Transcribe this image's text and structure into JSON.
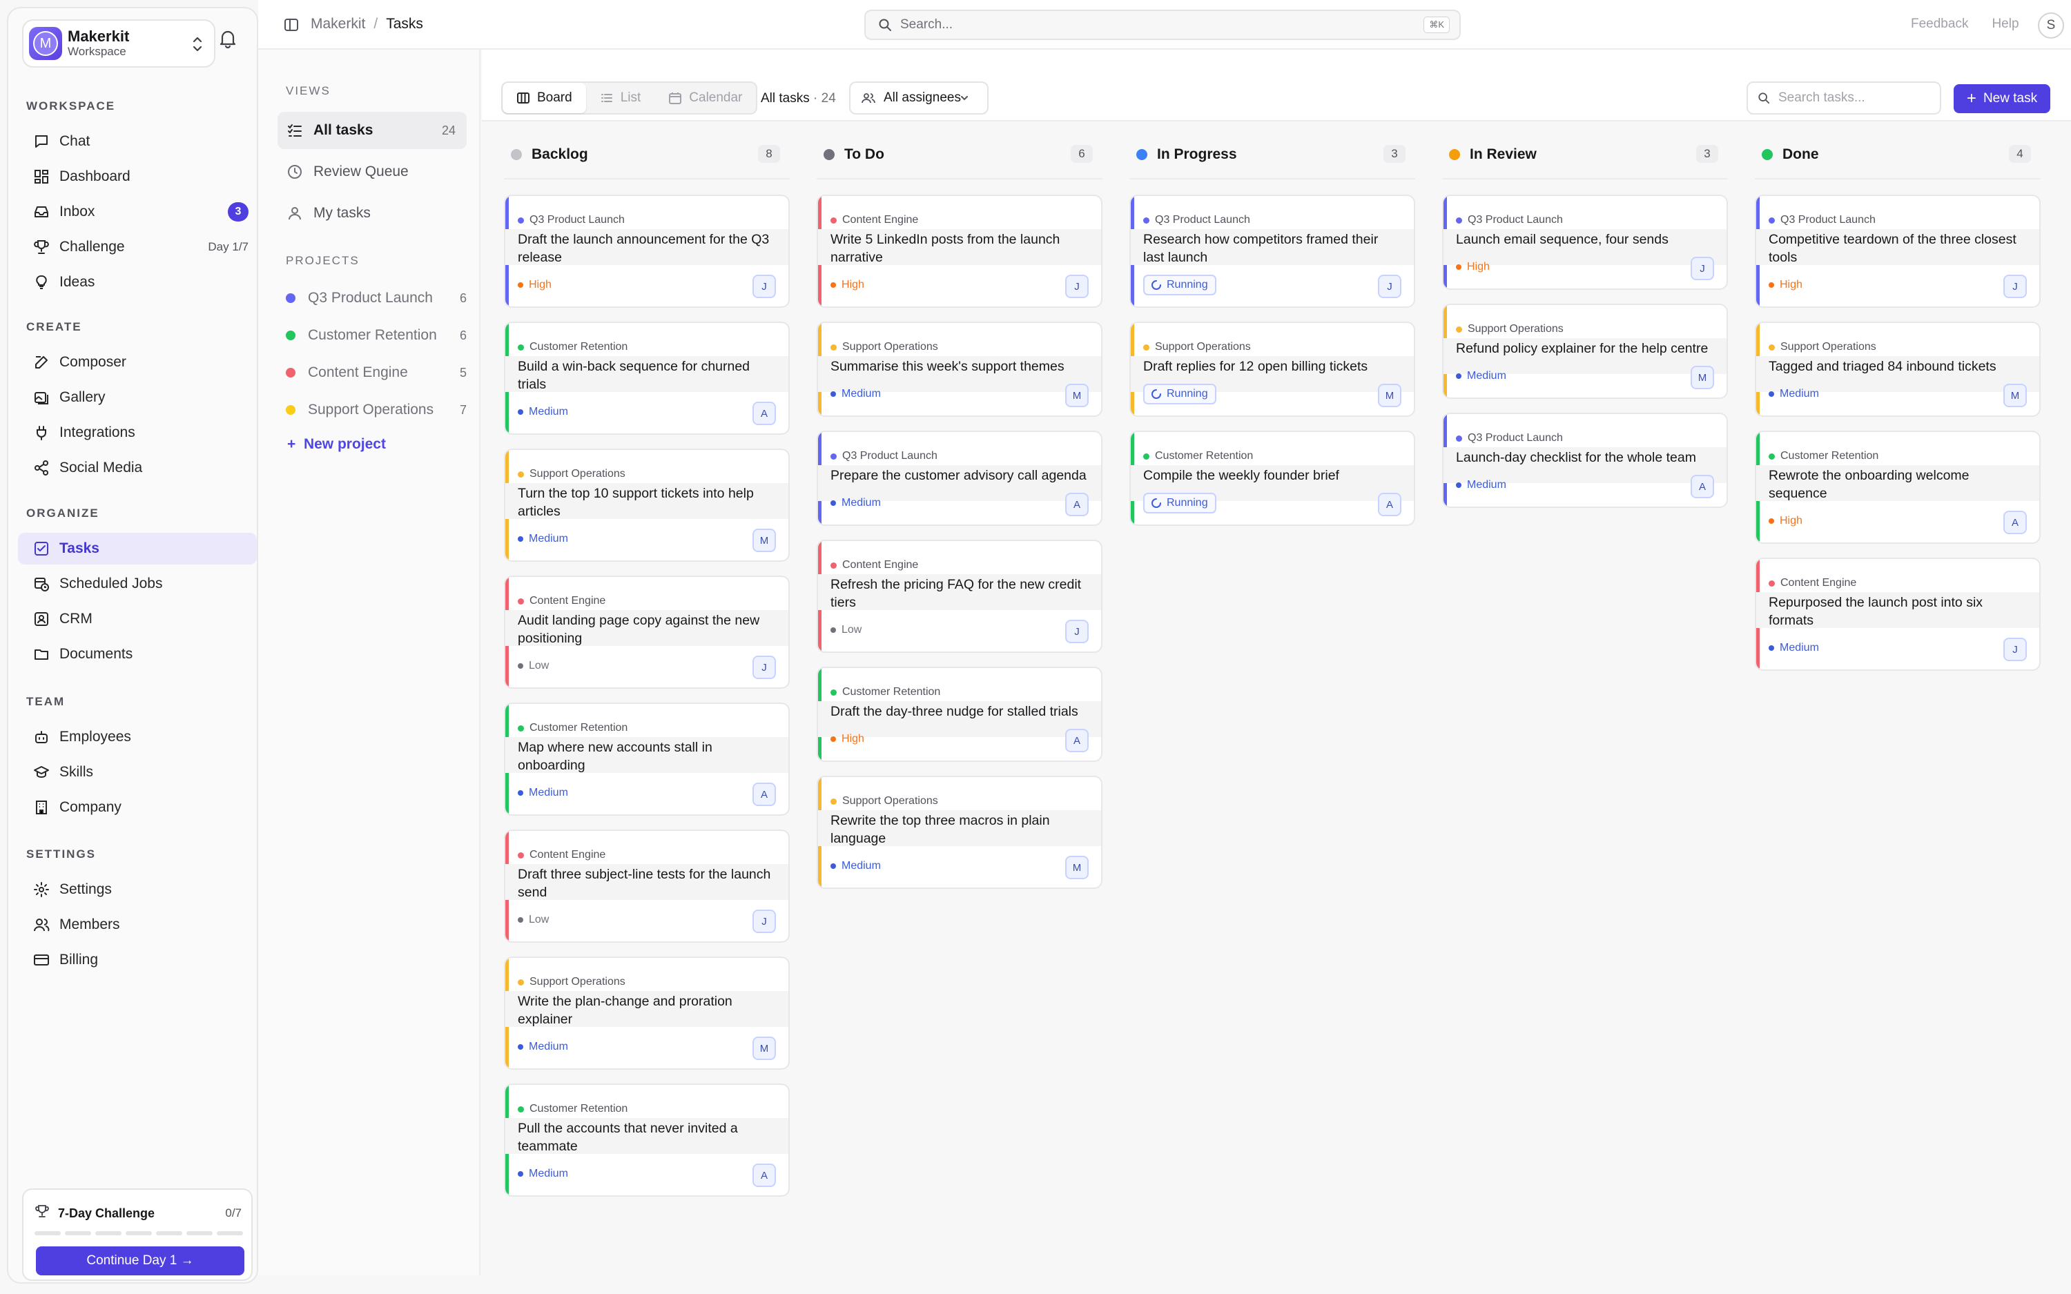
{
  "workspace": {
    "name": "Makerkit",
    "sub": "Workspace",
    "initial": "M"
  },
  "sidebar": {
    "sections": [
      {
        "title": "WORKSPACE",
        "items": [
          {
            "label": "Chat",
            "icon": "chat-icon"
          },
          {
            "label": "Dashboard",
            "icon": "dashboard-icon"
          },
          {
            "label": "Inbox",
            "icon": "inbox-icon",
            "badge": "3"
          },
          {
            "label": "Challenge",
            "icon": "trophy-icon",
            "meta": "Day 1/7"
          },
          {
            "label": "Ideas",
            "icon": "lightbulb-icon"
          }
        ]
      },
      {
        "title": "CREATE",
        "items": [
          {
            "label": "Composer",
            "icon": "composer-icon"
          },
          {
            "label": "Gallery",
            "icon": "gallery-icon"
          },
          {
            "label": "Integrations",
            "icon": "plug-icon"
          },
          {
            "label": "Social Media",
            "icon": "share-icon"
          }
        ]
      },
      {
        "title": "ORGANIZE",
        "items": [
          {
            "label": "Tasks",
            "icon": "tasks-icon",
            "active": true
          },
          {
            "label": "Scheduled Jobs",
            "icon": "calendar-clock-icon"
          },
          {
            "label": "CRM",
            "icon": "contact-icon"
          },
          {
            "label": "Documents",
            "icon": "folder-icon"
          }
        ]
      },
      {
        "title": "TEAM",
        "items": [
          {
            "label": "Employees",
            "icon": "bot-icon"
          },
          {
            "label": "Skills",
            "icon": "graduation-icon"
          },
          {
            "label": "Company",
            "icon": "building-icon"
          }
        ]
      },
      {
        "title": "SETTINGS",
        "items": [
          {
            "label": "Settings",
            "icon": "gear-icon"
          },
          {
            "label": "Members",
            "icon": "users-icon"
          },
          {
            "label": "Billing",
            "icon": "credit-card-icon"
          }
        ]
      }
    ],
    "challenge": {
      "title": "7-Day Challenge",
      "count": "0/7",
      "button": "Continue Day 1 →"
    }
  },
  "header": {
    "crumb_root": "Makerkit",
    "crumb_current": "Tasks",
    "search_placeholder": "Search...",
    "shortcut": "⌘K",
    "feedback": "Feedback",
    "help": "Help",
    "avatar": "S"
  },
  "views": {
    "title": "VIEWS",
    "items": [
      {
        "label": "All tasks",
        "count": "24",
        "active": true
      },
      {
        "label": "Review Queue"
      },
      {
        "label": "My tasks"
      }
    ],
    "projects_title": "PROJECTS",
    "projects": [
      {
        "label": "Q3 Product Launch",
        "count": "6",
        "color": "#6366f1"
      },
      {
        "label": "Customer Retention",
        "count": "6",
        "color": "#22c55e"
      },
      {
        "label": "Content Engine",
        "count": "5",
        "color": "#f0626e"
      },
      {
        "label": "Support Operations",
        "count": "7",
        "color": "#facc15"
      }
    ],
    "new_project": "New project"
  },
  "toolbar": {
    "board": "Board",
    "list": "List",
    "calendar": "Calendar",
    "all_tasks": "All tasks",
    "all_tasks_count": "· 24",
    "assignees": "All assignees",
    "search_placeholder": "Search tasks...",
    "new_task": "New task"
  },
  "colors": {
    "q3": "#6366f1",
    "cr": "#22c55e",
    "ce": "#f0626e",
    "so": "#f5b82e",
    "high": "#f97316",
    "medium": "#3b5bdb",
    "low": "#71717a"
  },
  "board": [
    {
      "title": "Backlog",
      "count": "8",
      "color": "#c4c4c8",
      "cards": [
        {
          "project": "Q3 Product Launch",
          "pc": "q3",
          "title": "Draft the launch announcement for the Q3 release",
          "priority": "High",
          "assignee": "J"
        },
        {
          "project": "Customer Retention",
          "pc": "cr",
          "title": "Build a win-back sequence for churned trials",
          "priority": "Medium",
          "assignee": "A"
        },
        {
          "project": "Support Operations",
          "pc": "so",
          "title": "Turn the top 10 support tickets into help articles",
          "priority": "Medium",
          "assignee": "M"
        },
        {
          "project": "Content Engine",
          "pc": "ce",
          "title": "Audit landing page copy against the new positioning",
          "priority": "Low",
          "assignee": "J"
        },
        {
          "project": "Customer Retention",
          "pc": "cr",
          "title": "Map where new accounts stall in onboarding",
          "priority": "Medium",
          "assignee": "A"
        },
        {
          "project": "Content Engine",
          "pc": "ce",
          "title": "Draft three subject-line tests for the launch send",
          "priority": "Low",
          "assignee": "J"
        },
        {
          "project": "Support Operations",
          "pc": "so",
          "title": "Write the plan-change and proration explainer",
          "priority": "Medium",
          "assignee": "M"
        },
        {
          "project": "Customer Retention",
          "pc": "cr",
          "title": "Pull the accounts that never invited a teammate",
          "priority": "Medium",
          "assignee": "A"
        }
      ]
    },
    {
      "title": "To Do",
      "count": "6",
      "color": "#71717a",
      "cards": [
        {
          "project": "Content Engine",
          "pc": "ce",
          "title": "Write 5 LinkedIn posts from the launch narrative",
          "priority": "High",
          "assignee": "J"
        },
        {
          "project": "Support Operations",
          "pc": "so",
          "title": "Summarise this week's support themes",
          "priority": "Medium",
          "assignee": "M"
        },
        {
          "project": "Q3 Product Launch",
          "pc": "q3",
          "title": "Prepare the customer advisory call agenda",
          "priority": "Medium",
          "assignee": "A"
        },
        {
          "project": "Content Engine",
          "pc": "ce",
          "title": "Refresh the pricing FAQ for the new credit tiers",
          "priority": "Low",
          "assignee": "J"
        },
        {
          "project": "Customer Retention",
          "pc": "cr",
          "title": "Draft the day-three nudge for stalled trials",
          "priority": "High",
          "assignee": "A"
        },
        {
          "project": "Support Operations",
          "pc": "so",
          "title": "Rewrite the top three macros in plain language",
          "priority": "Medium",
          "assignee": "M"
        }
      ]
    },
    {
      "title": "In Progress",
      "count": "3",
      "color": "#3b82f6",
      "cards": [
        {
          "project": "Q3 Product Launch",
          "pc": "q3",
          "title": "Research how competitors framed their last launch",
          "status": "Running",
          "assignee": "J"
        },
        {
          "project": "Support Operations",
          "pc": "so",
          "title": "Draft replies for 12 open billing tickets",
          "status": "Running",
          "assignee": "M"
        },
        {
          "project": "Customer Retention",
          "pc": "cr",
          "title": "Compile the weekly founder brief",
          "status": "Running",
          "assignee": "A"
        }
      ]
    },
    {
      "title": "In Review",
      "count": "3",
      "color": "#f59e0b",
      "cards": [
        {
          "project": "Q3 Product Launch",
          "pc": "q3",
          "title": "Launch email sequence, four sends",
          "priority": "High",
          "assignee": "J"
        },
        {
          "project": "Support Operations",
          "pc": "so",
          "title": "Refund policy explainer for the help centre",
          "priority": "Medium",
          "assignee": "M"
        },
        {
          "project": "Q3 Product Launch",
          "pc": "q3",
          "title": "Launch-day checklist for the whole team",
          "priority": "Medium",
          "assignee": "A"
        }
      ]
    },
    {
      "title": "Done",
      "count": "4",
      "color": "#22c55e",
      "cards": [
        {
          "project": "Q3 Product Launch",
          "pc": "q3",
          "title": "Competitive teardown of the three closest tools",
          "priority": "High",
          "assignee": "J"
        },
        {
          "project": "Support Operations",
          "pc": "so",
          "title": "Tagged and triaged 84 inbound tickets",
          "priority": "Medium",
          "assignee": "M"
        },
        {
          "project": "Customer Retention",
          "pc": "cr",
          "title": "Rewrote the onboarding welcome sequence",
          "priority": "High",
          "assignee": "A"
        },
        {
          "project": "Content Engine",
          "pc": "ce",
          "title": "Repurposed the launch post into six formats",
          "priority": "Medium",
          "assignee": "J"
        }
      ]
    }
  ]
}
